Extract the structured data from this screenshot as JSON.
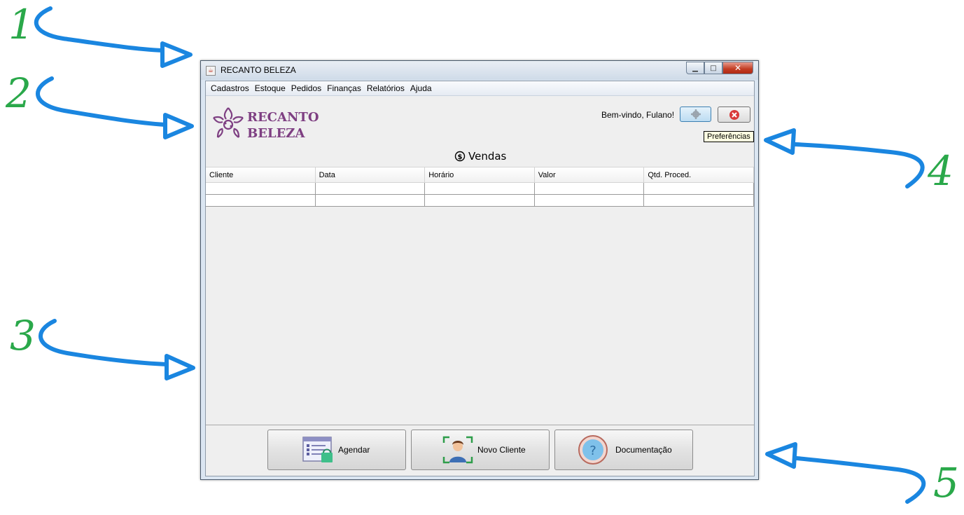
{
  "annotations": [
    "1",
    "2",
    "3",
    "4",
    "5"
  ],
  "window": {
    "title": "RECANTO BELEZA",
    "controls": {
      "minimize": "minimize-icon",
      "maximize": "maximize-icon",
      "close": "close-icon"
    }
  },
  "menubar": {
    "items": [
      "Cadastros",
      "Estoque",
      "Pedidos",
      "Finanças",
      "Relatórios",
      "Ajuda"
    ]
  },
  "header": {
    "logo_line1": "RECANTO",
    "logo_line2": "BELEZA",
    "welcome": "Bem-vindo, Fulano!",
    "tooltip": "Preferências"
  },
  "section": {
    "title": "Vendas",
    "icon": "money-icon"
  },
  "table": {
    "columns": [
      "Cliente",
      "Data",
      "Horário",
      "Valor",
      "Qtd. Proced."
    ],
    "rows": [
      [
        "",
        "",
        "",
        "",
        ""
      ],
      [
        "",
        "",
        "",
        "",
        ""
      ]
    ]
  },
  "actions": {
    "schedule": "Agendar",
    "new_client": "Novo Cliente",
    "docs": "Documentação"
  },
  "colors": {
    "brand": "#7e3f82",
    "annotation_number": "#2aa84a",
    "annotation_arrow": "#1a86e0"
  }
}
